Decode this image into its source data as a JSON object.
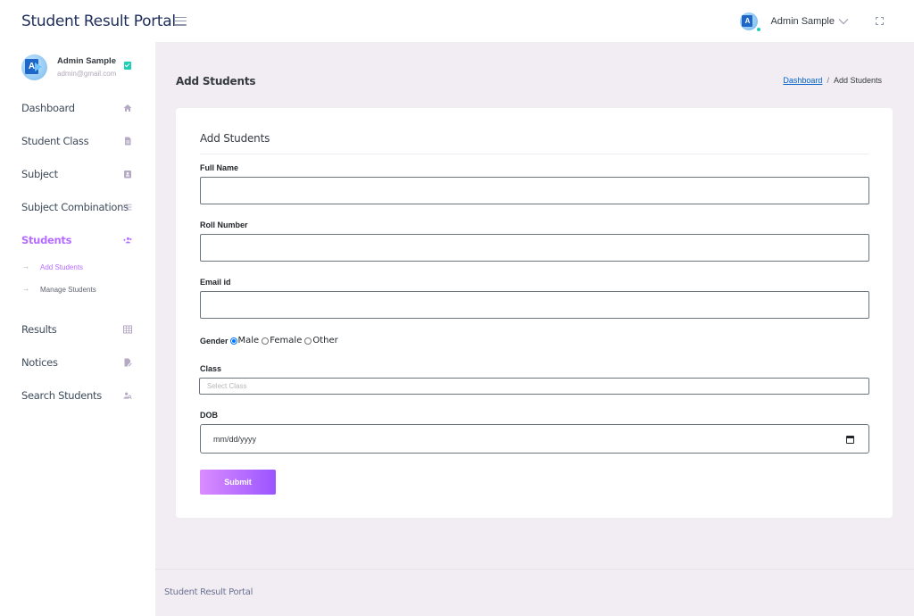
{
  "app": {
    "brand": "Student Result Portal",
    "footer_text": "Student Result Portal"
  },
  "navbar": {
    "username": "Admin Sample",
    "avatar_glyph": "A"
  },
  "sidebar": {
    "profile": {
      "name": "Admin Sample",
      "email": "admin@gmail.com",
      "avatar_glyph": "A"
    },
    "items": [
      {
        "label": "Dashboard",
        "icon": "home-icon"
      },
      {
        "label": "Student Class",
        "icon": "document-icon"
      },
      {
        "label": "Subject",
        "icon": "contacts-icon"
      },
      {
        "label": "Subject Combinations",
        "icon": "list-icon"
      },
      {
        "label": "Students",
        "icon": "add-users-icon",
        "active": true
      },
      {
        "label": "Results",
        "icon": "grid-icon"
      },
      {
        "label": "Notices",
        "icon": "notice-icon"
      },
      {
        "label": "Search Students",
        "icon": "search-user-icon"
      }
    ],
    "students_sub": [
      {
        "arrow": "→",
        "label": "Add Students",
        "active": true
      },
      {
        "arrow": "→",
        "label": "Manage Students"
      }
    ]
  },
  "page": {
    "title": "Add Students",
    "breadcrumb": {
      "link": "Dashboard",
      "separator": "/",
      "current": "Add Students"
    }
  },
  "form": {
    "title": "Add Students",
    "full_name": {
      "label": "Full Name",
      "value": ""
    },
    "roll_number": {
      "label": "Roll Number",
      "value": ""
    },
    "email": {
      "label": "Email id",
      "value": ""
    },
    "gender": {
      "label": "Gender",
      "options": [
        "Male",
        "Female",
        "Other"
      ],
      "selected": "Male"
    },
    "class": {
      "label": "Class",
      "placeholder": "Select Class"
    },
    "dob": {
      "label": "DOB",
      "placeholder": "mm/dd/yyyy"
    },
    "submit_label": "Submit"
  },
  "colors": {
    "accent": "#b66dff",
    "button_gradient_start": "#da8cff",
    "button_gradient_end": "#9a55ff",
    "status_green": "#1bcfb4",
    "background": "#f2edf3"
  }
}
